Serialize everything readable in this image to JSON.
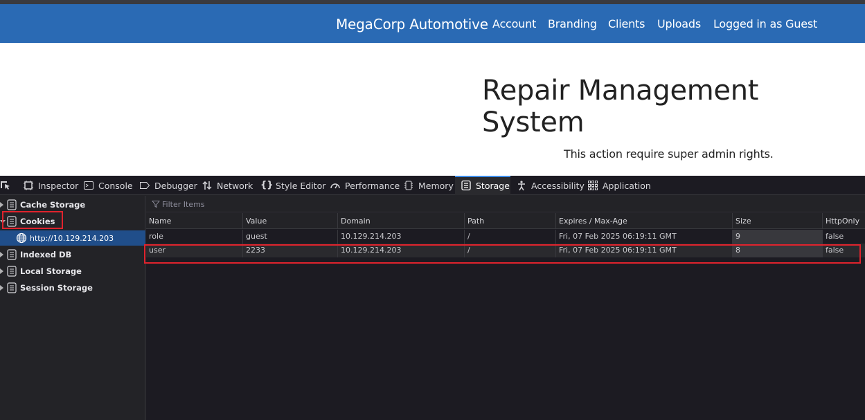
{
  "navbar": {
    "brand": "MegaCorp Automotive",
    "links": [
      "Account",
      "Branding",
      "Clients",
      "Uploads",
      "Logged in as Guest"
    ]
  },
  "page": {
    "title": "Repair Management System",
    "message": "This action require super admin rights."
  },
  "devtools": {
    "tabs": [
      "Inspector",
      "Console",
      "Debugger",
      "Network",
      "Style Editor",
      "Performance",
      "Memory",
      "Storage",
      "Accessibility",
      "Application"
    ],
    "active_tab": "Storage",
    "sidebar": {
      "items": [
        "Cache Storage",
        "Cookies",
        "Indexed DB",
        "Local Storage",
        "Session Storage"
      ],
      "selected_host": "http://10.129.214.203"
    },
    "filter_placeholder": "Filter Items",
    "columns": [
      "Name",
      "Value",
      "Domain",
      "Path",
      "Expires / Max-Age",
      "Size",
      "HttpOnly"
    ],
    "rows": [
      [
        "role",
        "guest",
        "10.129.214.203",
        "/",
        "Fri, 07 Feb 2025 06:19:11 GMT",
        "9",
        "false"
      ],
      [
        "user",
        "2233",
        "10.129.214.203",
        "/",
        "Fri, 07 Feb 2025 06:19:11 GMT",
        "8",
        "false"
      ]
    ]
  },
  "colors": {
    "navbar": "#2a6ab4",
    "highlight": "#e0232d",
    "selection": "#204e8a"
  }
}
